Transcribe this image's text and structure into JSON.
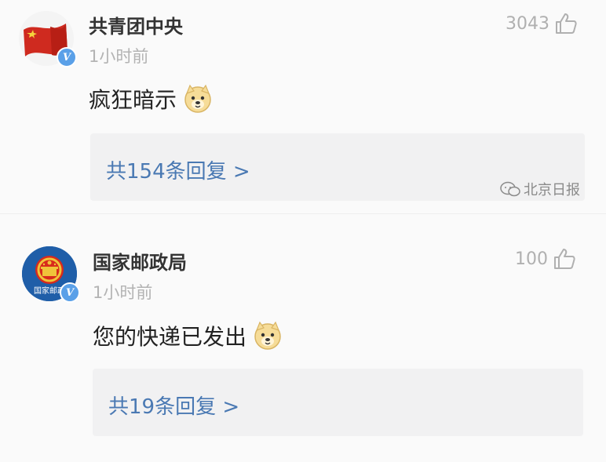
{
  "comments": [
    {
      "author": "共青团中央",
      "time": "1小时前",
      "likes": "3043",
      "text": "疯狂暗示",
      "emoji": "doge-emoji",
      "replies": "共154条回复 >",
      "watermark": "北京日报"
    },
    {
      "author": "国家邮政局",
      "time": "1小时前",
      "likes": "100",
      "text": "您的快递已发出",
      "emoji": "doge-emoji",
      "replies": "共19条回复 >",
      "avatar_caption": "国家邮政"
    }
  ],
  "colors": {
    "link": "#4a79b3",
    "verified": "#5aa0e8",
    "avatar1_bg": "#c8281e",
    "avatar2_bg": "#1f5ea8"
  }
}
